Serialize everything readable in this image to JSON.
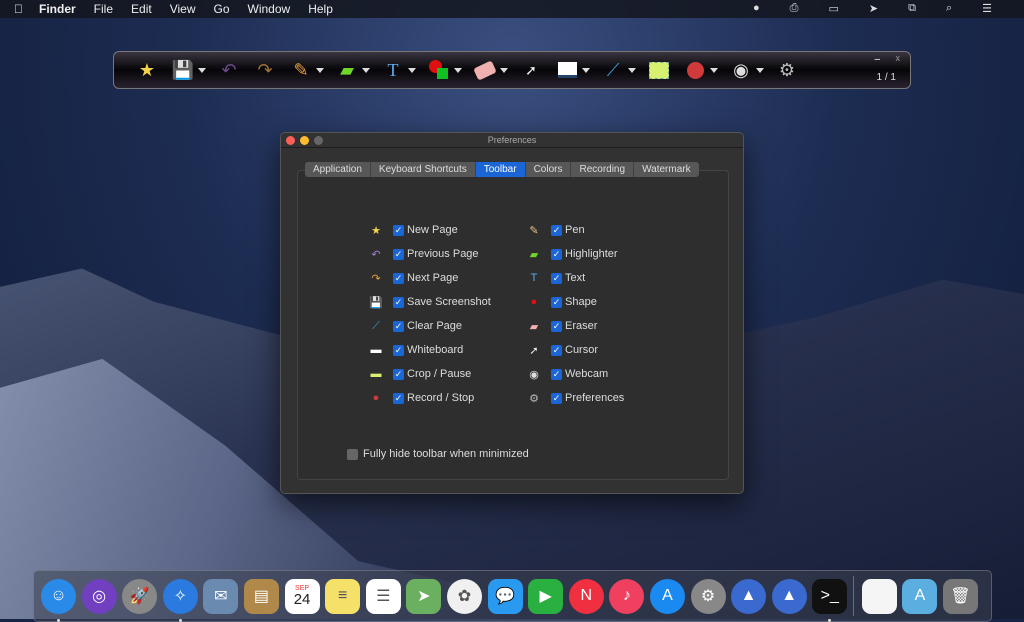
{
  "menubar": {
    "app": "Finder",
    "items": [
      "File",
      "Edit",
      "View",
      "Go",
      "Window",
      "Help"
    ],
    "status_icons": [
      "record-icon",
      "printer-icon",
      "display-icon",
      "cursor-icon",
      "screen-mirror-icon",
      "search-icon",
      "control-center-icon"
    ]
  },
  "toolbar": {
    "page_indicator": "1 / 1",
    "minimize": "–",
    "close": "x",
    "tools": [
      "new-page",
      "save-screenshot",
      "previous-page",
      "next-page",
      "pen",
      "highlighter",
      "text",
      "shape",
      "eraser",
      "cursor",
      "whiteboard",
      "clear-page",
      "crop-pause",
      "record-stop",
      "webcam",
      "preferences"
    ]
  },
  "prefs": {
    "title": "Preferences",
    "tabs": [
      "Application",
      "Keyboard Shortcuts",
      "Toolbar",
      "Colors",
      "Recording",
      "Watermark"
    ],
    "active_tab": "Toolbar",
    "left": [
      {
        "label": "New Page",
        "icon": "new-page-icon",
        "checked": true
      },
      {
        "label": "Previous Page",
        "icon": "previous-page-icon",
        "checked": true
      },
      {
        "label": "Next Page",
        "icon": "next-page-icon",
        "checked": true
      },
      {
        "label": "Save Screenshot",
        "icon": "save-icon",
        "checked": true
      },
      {
        "label": "Clear Page",
        "icon": "clear-page-icon",
        "checked": true
      },
      {
        "label": "Whiteboard",
        "icon": "whiteboard-icon",
        "checked": true
      },
      {
        "label": "Crop / Pause",
        "icon": "crop-icon",
        "checked": true
      },
      {
        "label": "Record / Stop",
        "icon": "record-icon",
        "checked": true
      }
    ],
    "right": [
      {
        "label": "Pen",
        "icon": "pen-icon",
        "checked": true
      },
      {
        "label": "Highlighter",
        "icon": "highlighter-icon",
        "checked": true
      },
      {
        "label": "Text",
        "icon": "text-icon",
        "checked": true
      },
      {
        "label": "Shape",
        "icon": "shape-icon",
        "checked": true
      },
      {
        "label": "Eraser",
        "icon": "eraser-icon",
        "checked": true
      },
      {
        "label": "Cursor",
        "icon": "cursor-icon",
        "checked": true
      },
      {
        "label": "Webcam",
        "icon": "webcam-icon",
        "checked": true
      },
      {
        "label": "Preferences",
        "icon": "gear-icon",
        "checked": true
      }
    ],
    "hide_toolbar": {
      "label": "Fully hide toolbar when minimized",
      "checked": false
    }
  },
  "calendar": {
    "month": "SEP",
    "day": "24"
  },
  "dock": [
    "finder",
    "siri",
    "launchpad",
    "safari",
    "mail",
    "contacts",
    "calendar",
    "notes",
    "reminders",
    "maps",
    "photos",
    "messages",
    "facetime",
    "news",
    "music",
    "app-store",
    "system-preferences",
    "app",
    "app",
    "terminal",
    "|",
    "document",
    "applications-folder",
    "trash"
  ]
}
